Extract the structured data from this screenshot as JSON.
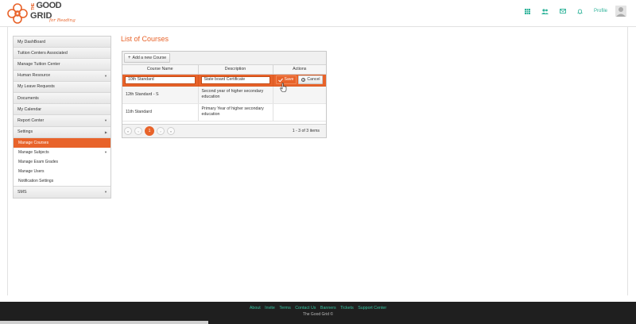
{
  "brand": {
    "the": "THE",
    "line1": "GOOD",
    "line2": "GRID",
    "tagline": "for Reading"
  },
  "topnav": {
    "icons": [
      "grid-icon",
      "users-icon",
      "mail-icon",
      "bell-icon"
    ],
    "profile_label": "Profile"
  },
  "sidebar": {
    "items": [
      {
        "label": "My DashBoard"
      },
      {
        "label": "Tuition Centers Associated"
      },
      {
        "label": "Manage Tuition Center"
      },
      {
        "label": "Human Resource"
      },
      {
        "label": "My Leave Requests"
      },
      {
        "label": "Documents"
      },
      {
        "label": "My Calendar"
      },
      {
        "label": "Report Center"
      },
      {
        "label": "Settings"
      }
    ],
    "settings_sub": [
      {
        "label": "Manage Courses"
      },
      {
        "label": "Manage Subjects"
      },
      {
        "label": "Manage Exam Grades"
      },
      {
        "label": "Manage Users"
      },
      {
        "label": "Notification Settings"
      }
    ],
    "sms_label": "SMS"
  },
  "main": {
    "title": "List of Courses",
    "add_button": "Add a new Course",
    "columns": [
      "Course Name",
      "Description",
      "Actions"
    ],
    "edit_row": {
      "name_value": "10th Standard",
      "desc_value": "State board Certificate",
      "save_label": "Save",
      "cancel_label": "Cancel"
    },
    "rows": [
      {
        "name": "12th Standard - S",
        "desc": "Second year of higher secondary education"
      },
      {
        "name": "11th Standard",
        "desc": "Primary Year of higher secondary education"
      }
    ],
    "pager": {
      "first": "«",
      "prev": "‹",
      "current": "1",
      "next": "›",
      "last": "»",
      "info": "1 - 3 of 3 items"
    }
  },
  "footer": {
    "links": [
      "About",
      "Invite",
      "Terms",
      "Contact Us",
      "Banners",
      "Tickets",
      "Support Center"
    ],
    "copyright": "The Good Grid ©"
  },
  "colors": {
    "accent": "#e8632a",
    "teal": "#2fb39a",
    "footer_bg": "#1f1f1f"
  }
}
